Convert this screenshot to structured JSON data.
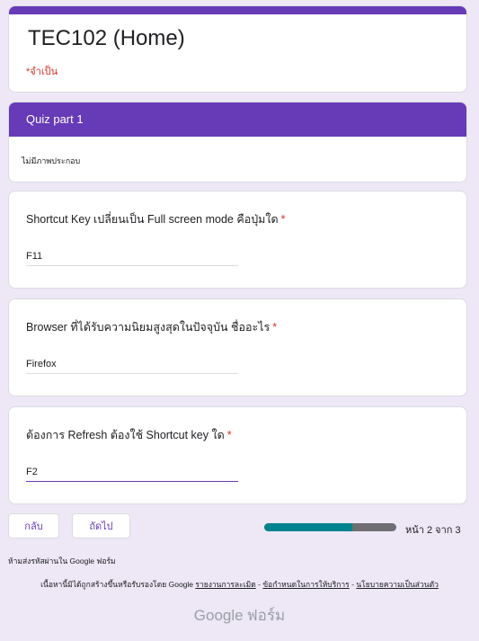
{
  "form": {
    "title": "TEC102 (Home)",
    "required_note": "*จำเป็น"
  },
  "section": {
    "title": "Quiz part 1",
    "description": "ไม่มีภาพประกอบ"
  },
  "questions": [
    {
      "label": "Shortcut Key เปลี่ยนเป็น Full screen mode คือปุ่มใด",
      "star": "*",
      "value": "F11"
    },
    {
      "label": "Browser ที่ได้รับความนิยมสูงสุดในปัจจุบัน ชื่ออะไร",
      "star": "*",
      "value": "Firefox"
    },
    {
      "label": "ต้องการ Refresh ต้องใช้ Shortcut key ใด",
      "star": "*",
      "value": "F2"
    }
  ],
  "nav": {
    "back_label": "กลับ",
    "next_label": "ถัดไป",
    "page_indicator": "หน้า 2 จาก 3",
    "progress_fraction": 0.667
  },
  "footer": {
    "password_note": "ห้ามส่งรหัสผ่านใน Google ฟอร์ม",
    "disclaimer": "เนื้อหานี้มิได้ถูกสร้างขึ้นหรือรับรองโดย Google",
    "links": [
      "รายงานการละเมิด",
      "ข้อกำหนดในการให้บริการ",
      "นโยบายความเป็นส่วนตัว"
    ],
    "separator": "-",
    "brand_google": "Google",
    "brand_forms": "ฟอร์ม"
  },
  "colors": {
    "theme": "#673ab7",
    "background": "#ede7f6",
    "required": "#d93025",
    "progress": "#00838f"
  }
}
